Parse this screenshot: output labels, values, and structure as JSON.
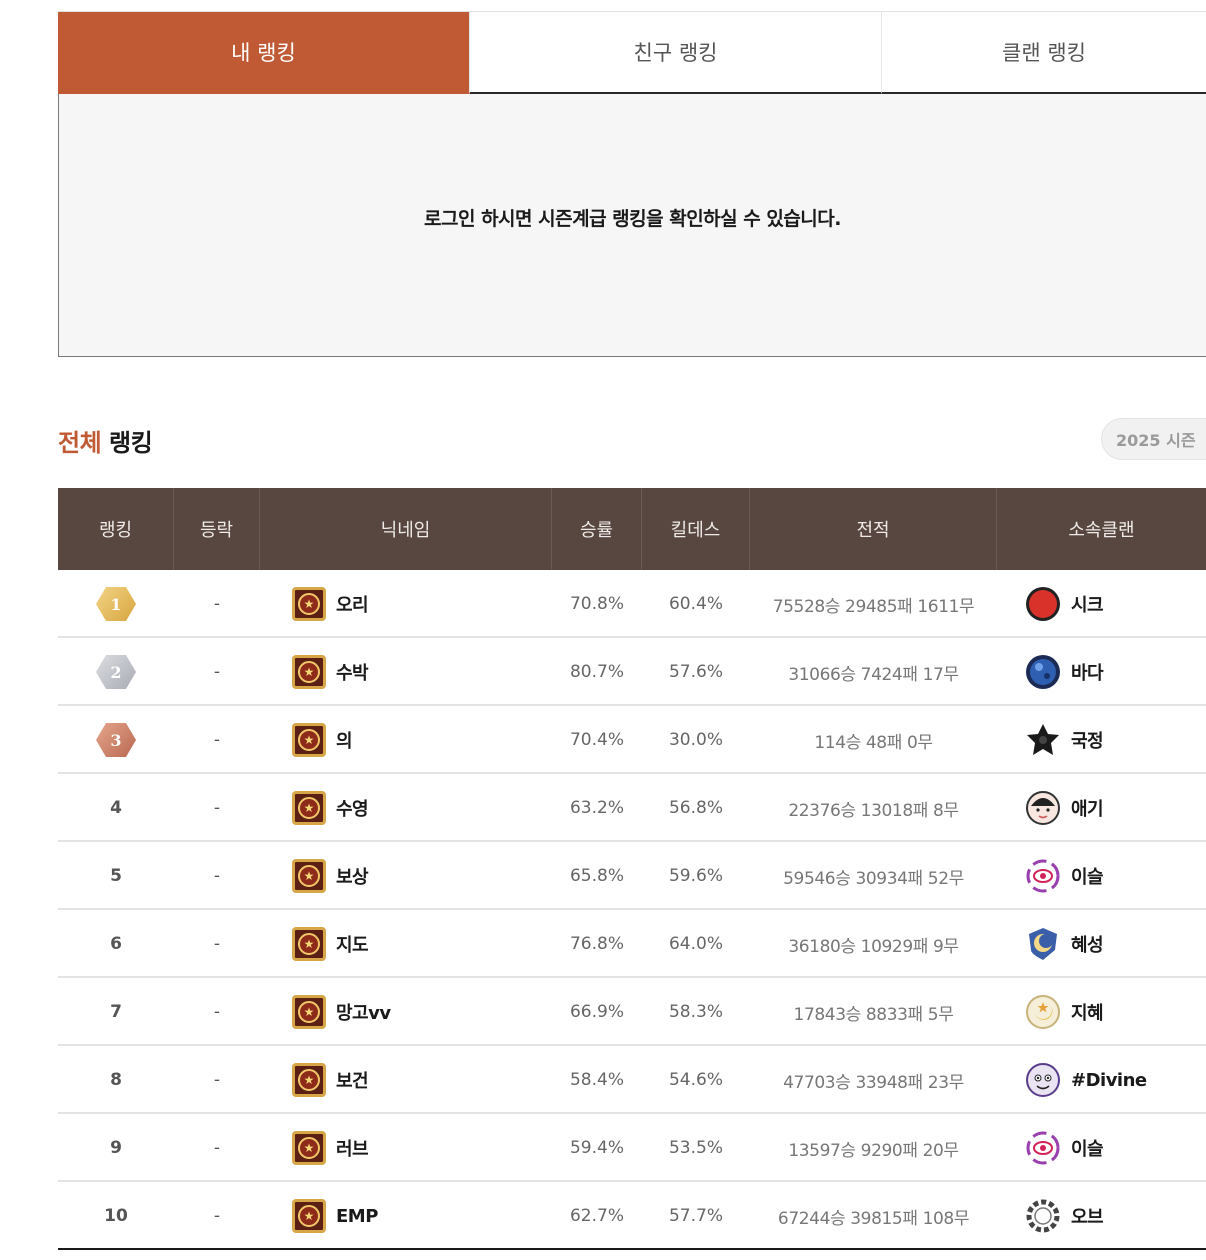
{
  "tabs": [
    {
      "label": "내 랭킹",
      "active": true
    },
    {
      "label": "친구 랭킹",
      "active": false
    },
    {
      "label": "클랜 랭킹",
      "active": false
    }
  ],
  "login_message": "로그인 하시면 시즌계급 랭킹을 확인하실 수 있습니다.",
  "section": {
    "title_accent": "전체",
    "title_rest": "랭킹",
    "season_label": "2025 시즌"
  },
  "table": {
    "headers": [
      "랭킹",
      "등락",
      "닉네임",
      "승률",
      "킬데스",
      "전적",
      "소속클랜"
    ],
    "rows": [
      {
        "rank": "1",
        "change": "-",
        "nickname": "오리",
        "winrate": "70.8%",
        "killdeath": "60.4%",
        "record": "75528승 29485패 1611무",
        "clan": "시크",
        "clan_icon": "red-circle-emblem"
      },
      {
        "rank": "2",
        "change": "-",
        "nickname": "수박",
        "winrate": "80.7%",
        "killdeath": "57.6%",
        "record": "31066승 7424패 17무",
        "clan": "바다",
        "clan_icon": "blue-orb-emblem"
      },
      {
        "rank": "3",
        "change": "-",
        "nickname": "의",
        "winrate": "70.4%",
        "killdeath": "30.0%",
        "record": "114승 48패 0무",
        "clan": "국정",
        "clan_icon": "black-flower-emblem"
      },
      {
        "rank": "4",
        "change": "-",
        "nickname": "수영",
        "winrate": "63.2%",
        "killdeath": "56.8%",
        "record": "22376승 13018패 8무",
        "clan": "애기",
        "clan_icon": "face-emblem"
      },
      {
        "rank": "5",
        "change": "-",
        "nickname": "보상",
        "winrate": "65.8%",
        "killdeath": "59.6%",
        "record": "59546승 30934패 52무",
        "clan": "이슬",
        "clan_icon": "purple-eye-emblem"
      },
      {
        "rank": "6",
        "change": "-",
        "nickname": "지도",
        "winrate": "76.8%",
        "killdeath": "64.0%",
        "record": "36180승 10929패 9무",
        "clan": "혜성",
        "clan_icon": "moon-shield-emblem"
      },
      {
        "rank": "7",
        "change": "-",
        "nickname": "망고vv",
        "winrate": "66.9%",
        "killdeath": "58.3%",
        "record": "17843승 8833패 5무",
        "clan": "지혜",
        "clan_icon": "star-moon-emblem"
      },
      {
        "rank": "8",
        "change": "-",
        "nickname": "보건",
        "winrate": "58.4%",
        "killdeath": "54.6%",
        "record": "47703승 33948패 23무",
        "clan": "#Divine",
        "clan_icon": "cartoon-emblem"
      },
      {
        "rank": "9",
        "change": "-",
        "nickname": "러브",
        "winrate": "59.4%",
        "killdeath": "53.5%",
        "record": "13597승 9290패 20무",
        "clan": "이슬",
        "clan_icon": "purple-eye-emblem"
      },
      {
        "rank": "10",
        "change": "-",
        "nickname": "EMP",
        "winrate": "62.7%",
        "killdeath": "57.7%",
        "record": "67244승 39815패 108무",
        "clan": "오브",
        "clan_icon": "chain-ring-emblem"
      }
    ]
  },
  "colors": {
    "accent": "#c05a34",
    "header_bg": "#574740",
    "gold": "#d7a53e",
    "silver": "#a8abb4",
    "bronze": "#b8694f"
  }
}
